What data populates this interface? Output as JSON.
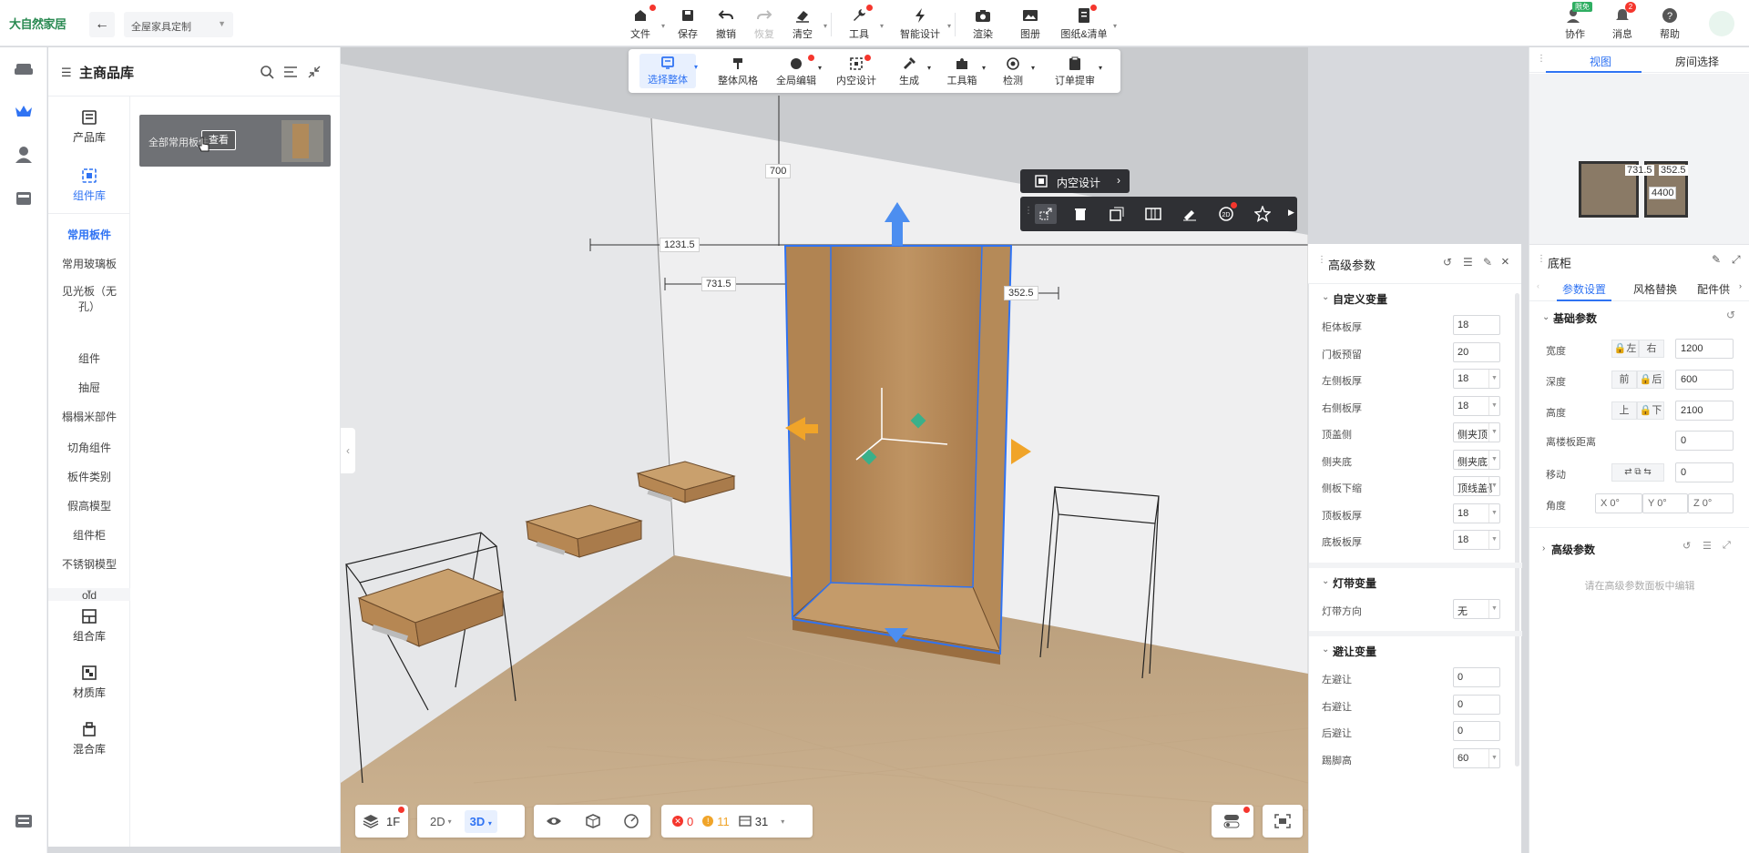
{
  "topbar": {
    "logo": "大自然家居",
    "back_icon": "arrow-left-icon",
    "project": "全屋家具定制",
    "items": [
      {
        "label": "文件",
        "icon": "file-icon"
      },
      {
        "label": "保存",
        "icon": "save-icon"
      },
      {
        "label": "撤销",
        "icon": "undo-icon"
      },
      {
        "label": "恢复",
        "icon": "redo-icon"
      },
      {
        "label": "清空",
        "icon": "eraser-icon"
      },
      {
        "label": "工具",
        "icon": "wrench-icon"
      },
      {
        "label": "智能设计",
        "icon": "lightning-icon"
      },
      {
        "label": "渲染",
        "icon": "camera-icon"
      },
      {
        "label": "图册",
        "icon": "image-icon"
      },
      {
        "label": "图纸&清单",
        "icon": "document-icon"
      }
    ],
    "right": [
      {
        "label": "协作",
        "badge": "限免"
      },
      {
        "label": "消息",
        "count": "2"
      },
      {
        "label": "帮助"
      }
    ]
  },
  "library": {
    "title": "主商品库",
    "categories": [
      {
        "label": "产品库"
      },
      {
        "label": "组件库"
      }
    ],
    "subcats": [
      "常用板件",
      "常用玻璃板",
      "见光板（无孔）",
      "组件",
      "抽屉",
      "榻榻米部件",
      "切角组件",
      "板件类别",
      "假高模型",
      "组件柜",
      "不锈钢模型",
      "old"
    ],
    "bottom": [
      {
        "label": "组合库"
      },
      {
        "label": "材质库"
      },
      {
        "label": "混合库"
      }
    ],
    "card": {
      "text": "全部常用板件",
      "button": "查看"
    }
  },
  "toolbar2": [
    {
      "label": "选择整体"
    },
    {
      "label": "整体风格"
    },
    {
      "label": "全局编辑"
    },
    {
      "label": "内空设计"
    },
    {
      "label": "生成"
    },
    {
      "label": "工具箱"
    },
    {
      "label": "检测"
    },
    {
      "label": "订单提审"
    }
  ],
  "context": {
    "pill": "内空设计"
  },
  "dims": {
    "top": "700",
    "left": "1231.5",
    "mid": "731.5",
    "right": "352.5"
  },
  "bottom": {
    "floor": "1F",
    "view2d": "2D",
    "view3d": "3D",
    "errors": "0",
    "warnings": "11",
    "count": "31"
  },
  "adv": {
    "title": "高级参数",
    "sections": [
      {
        "title": "自定义变量",
        "rows": [
          {
            "label": "柜体板厚",
            "value": "18"
          },
          {
            "label": "门板预留",
            "value": "20"
          },
          {
            "label": "左侧板厚",
            "value": "18",
            "dd": true
          },
          {
            "label": "右侧板厚",
            "value": "18",
            "dd": true
          },
          {
            "label": "顶盖侧",
            "value": "侧夹顶",
            "dd": true
          },
          {
            "label": "侧夹底",
            "value": "侧夹底",
            "dd": true
          },
          {
            "label": "侧板下缩",
            "value": "顶线盖侧",
            "dd": true
          },
          {
            "label": "顶板板厚",
            "value": "18",
            "dd": true
          },
          {
            "label": "底板板厚",
            "value": "18",
            "dd": true
          }
        ]
      },
      {
        "title": "灯带变量",
        "rows": [
          {
            "label": "灯带方向",
            "value": "无",
            "dd": true
          }
        ]
      },
      {
        "title": "避让变量",
        "rows": [
          {
            "label": "左避让",
            "value": "0"
          },
          {
            "label": "右避让",
            "value": "0"
          },
          {
            "label": "后避让",
            "value": "0"
          },
          {
            "label": "踢脚高",
            "value": "60",
            "dd": true
          }
        ]
      }
    ]
  },
  "rightpanel": {
    "tabs": [
      "视图",
      "房间选择"
    ],
    "map": {
      "a": "731.5",
      "b": "352.5",
      "c": "4400"
    },
    "title": "底柜",
    "subtabs": [
      "参数设置",
      "风格替换",
      "配件供"
    ],
    "basic": {
      "title": "基础参数",
      "width_label": "宽度",
      "w_left": "左",
      "w_right": "右",
      "width": "1200",
      "depth_label": "深度",
      "d_front": "前",
      "d_back": "后",
      "depth": "600",
      "height_label": "高度",
      "h_top": "上",
      "h_bottom": "下",
      "height": "2100",
      "floor_label": "离楼板距离",
      "floor": "0",
      "move_label": "移动",
      "move": "0",
      "angle_label": "角度",
      "ax": "X 0°",
      "ay": "Y 0°",
      "az": "Z 0°"
    },
    "adv_title": "高级参数",
    "adv_hint": "请在高级参数面板中编辑"
  }
}
